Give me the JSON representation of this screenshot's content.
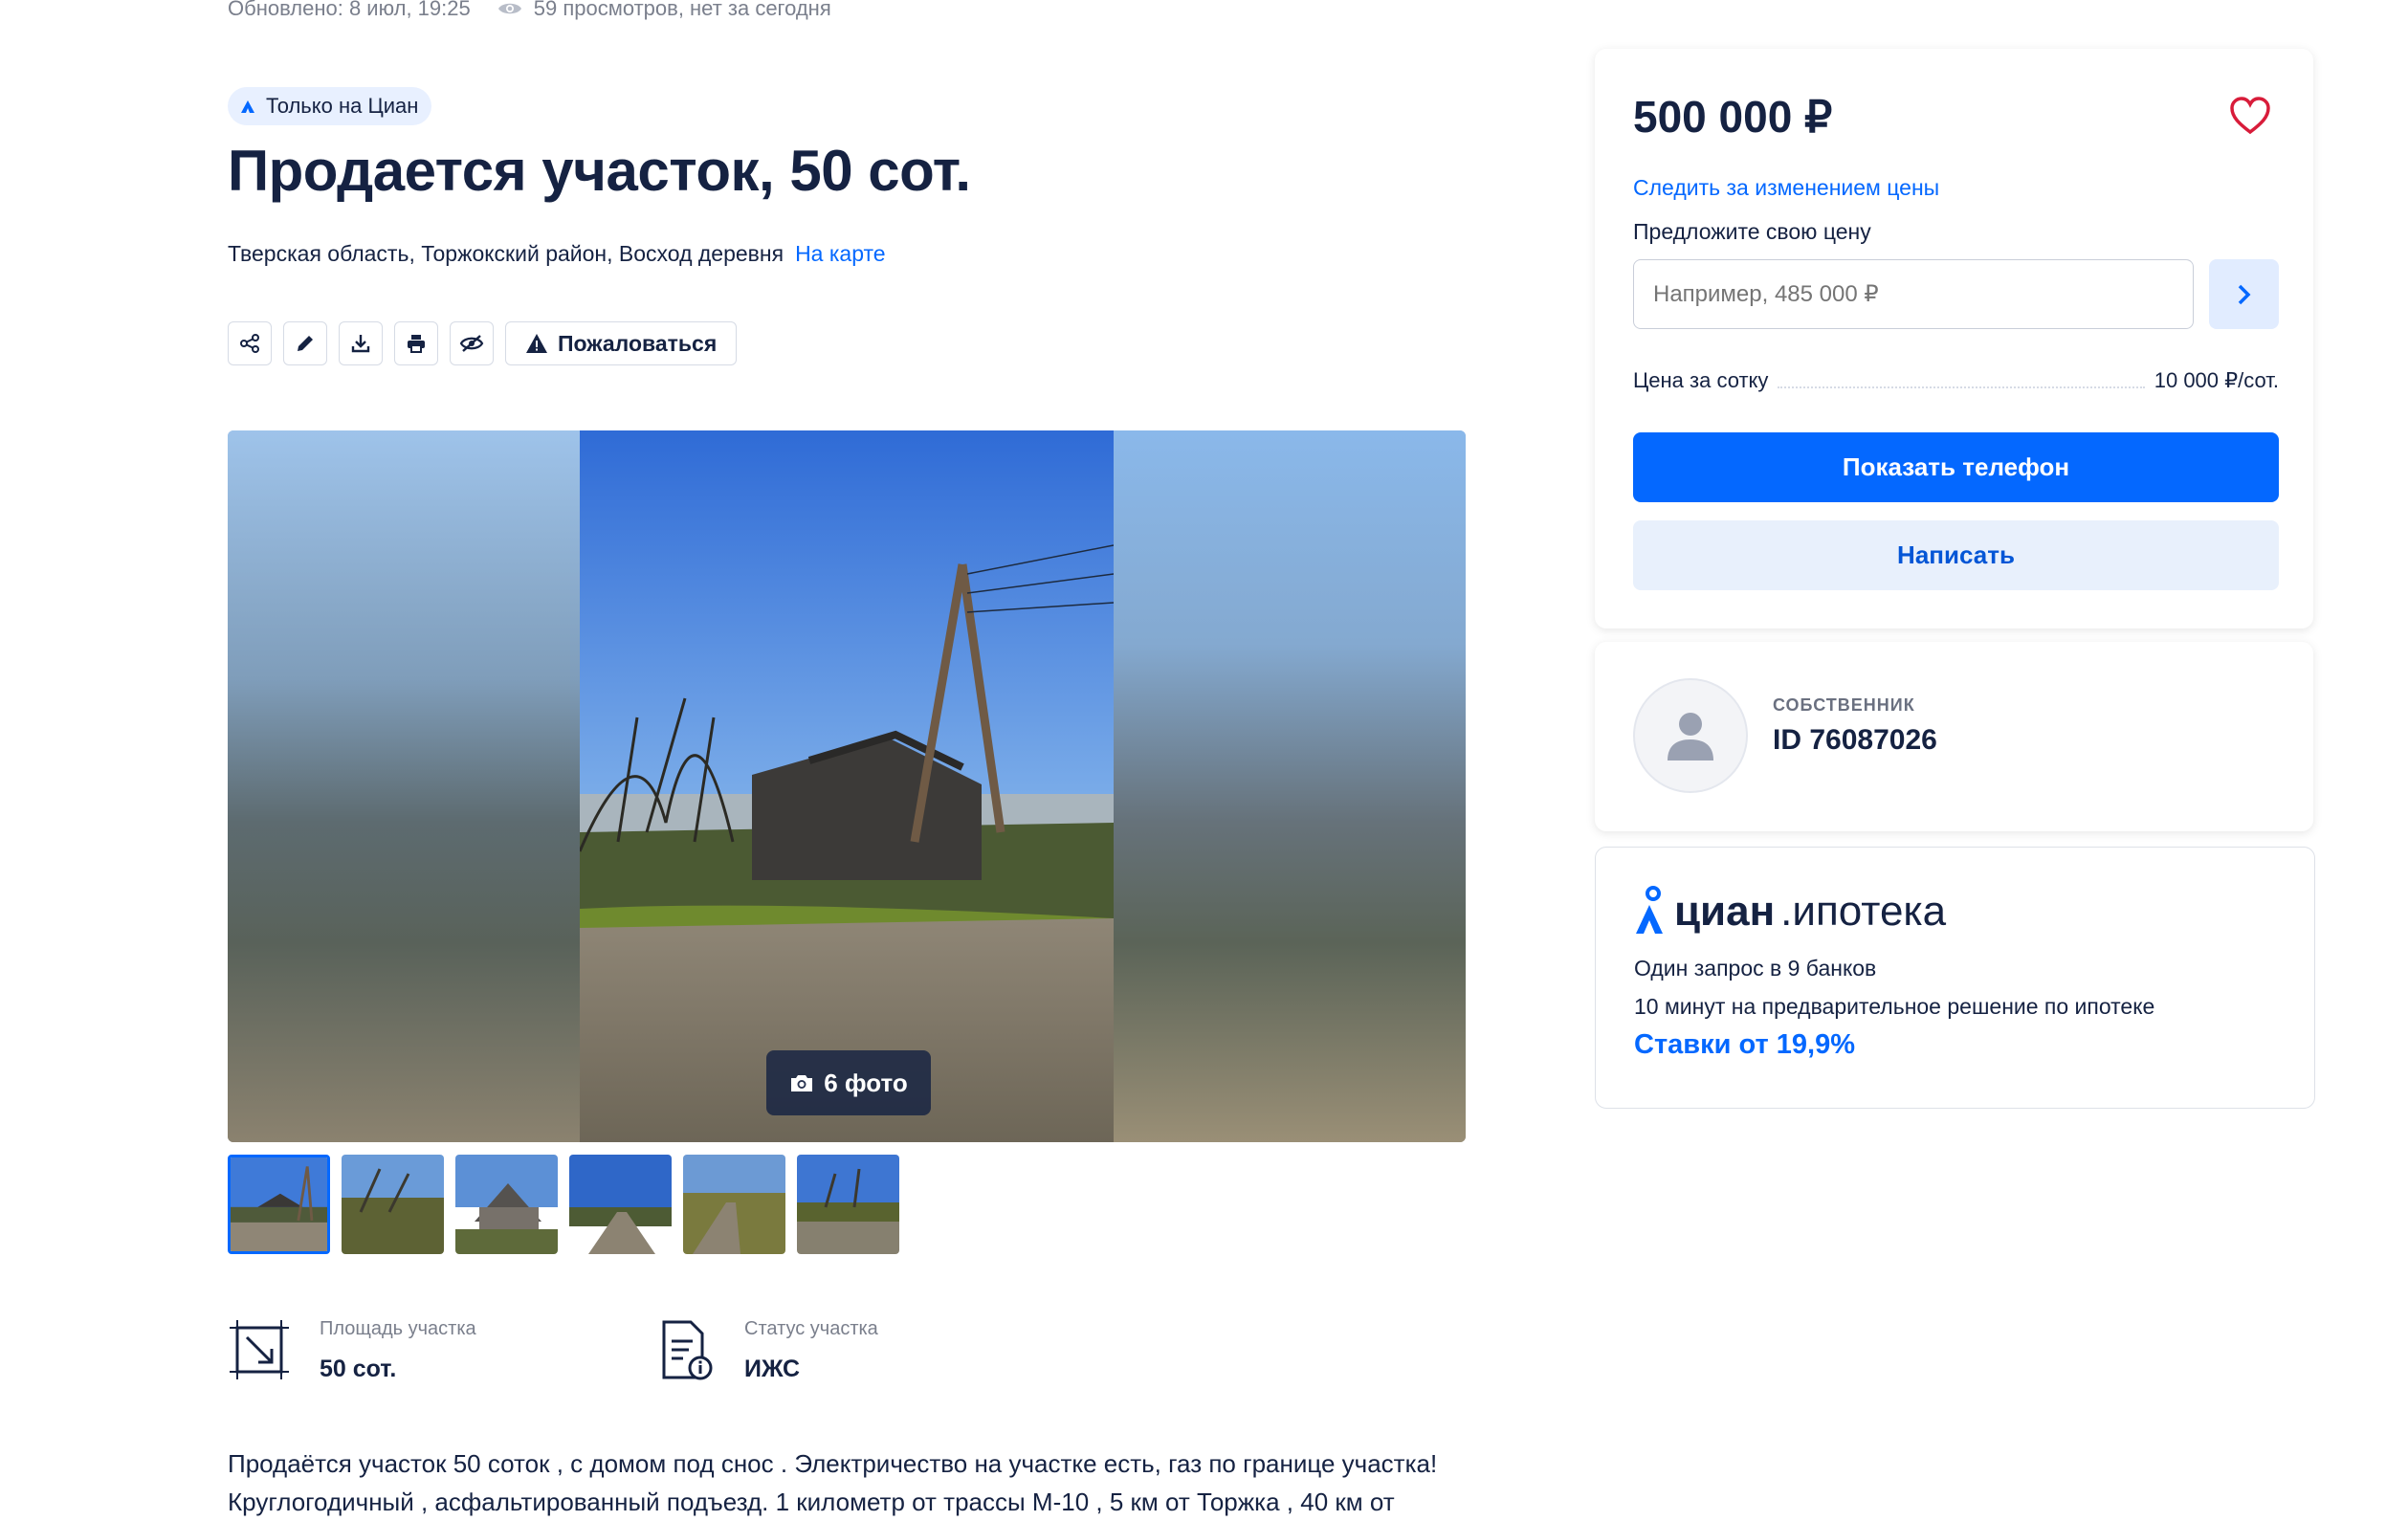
{
  "meta": {
    "updated": "Обновлено: 8 июл, 19:25",
    "views": "59 просмотров, нет за сегодня"
  },
  "badge": {
    "label": "Только на Циан"
  },
  "listing": {
    "title": "Продается участок, 50 сот.",
    "address": "Тверская область, Торжокский район, Восход деревня",
    "map_link": "На карте"
  },
  "toolbar": {
    "icons": [
      "share-icon",
      "edit-icon",
      "download-icon",
      "print-icon",
      "hide-icon"
    ],
    "report_label": "Пожаловаться"
  },
  "gallery": {
    "count_label": "6 фото",
    "thumbnails": 6,
    "active_index": 0
  },
  "features": [
    {
      "icon": "area-icon",
      "label": "Площадь участка",
      "value": "50 сот."
    },
    {
      "icon": "document-icon",
      "label": "Статус участка",
      "value": "ИЖС"
    }
  ],
  "description": "Продаётся участок 50 соток , с домом под снос . Электричество на участке есть, газ по границе участка! Круглогодичный , асфальтированный подъезд. 1 километр от  трассы М-10 , 5 км от Торжка , 40 км от",
  "price_card": {
    "price": "500 000 ₽",
    "track_link": "Следить за изменением цены",
    "offer_label": "Предложите свою цену",
    "offer_placeholder": "Например, 485 000 ₽",
    "price_per_unit_label": "Цена за сотку",
    "price_per_unit_value": "10 000 ₽/сот.",
    "phone_button": "Показать телефон",
    "write_button": "Написать"
  },
  "owner": {
    "role": "СОБСТВЕННИК",
    "id": "ID 76087026"
  },
  "mortgage": {
    "brand_a": "циан",
    "brand_b": ".ипотека",
    "line1": "Один запрос в 9 банков",
    "line2": "10 минут на предварительное решение по ипотеке",
    "rate": "Ставки от 19,9%"
  },
  "colors": {
    "accent": "#0468ff",
    "text": "#152242",
    "muted": "#7a7f8c",
    "heart": "#d81c3a"
  }
}
